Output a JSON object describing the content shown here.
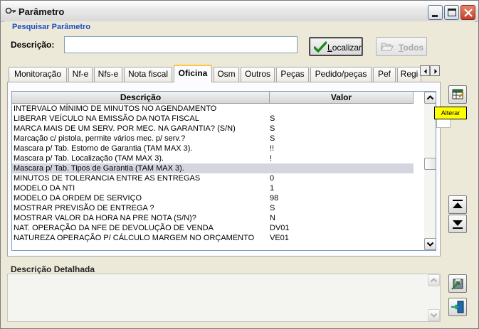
{
  "window": {
    "title": "Parâmetro"
  },
  "search": {
    "section_title": "Pesquisar Parâmetro",
    "description_label": "Descrição:",
    "description_value": "",
    "localizar_label_u": "L",
    "localizar_label_rest": "ocalizar",
    "todos_label_u": "T",
    "todos_label_rest": "odos"
  },
  "tabs": [
    {
      "label": "Monitoração"
    },
    {
      "label": "Nf-e"
    },
    {
      "label": "Nfs-e"
    },
    {
      "label": "Nota fiscal"
    },
    {
      "label": "Oficina",
      "active": true
    },
    {
      "label": "Osm"
    },
    {
      "label": "Outros"
    },
    {
      "label": "Peças"
    },
    {
      "label": "Pedido/peças"
    },
    {
      "label": "Pef"
    },
    {
      "label": "Regi"
    }
  ],
  "grid": {
    "columns": [
      "Descrição",
      "Valor"
    ],
    "rows": [
      {
        "desc": "INTERVALO MÍNIMO DE MINUTOS NO AGENDAMENTO",
        "value": ""
      },
      {
        "desc": "LIBERAR VEÍCULO NA EMISSÃO DA NOTA FISCAL",
        "value": "S"
      },
      {
        "desc": "MARCA MAIS DE UM SERV. POR MEC. NA GARANTIA? (S/N)",
        "value": "S"
      },
      {
        "desc": "Marcação c/ pistola, permite vários mec. p/ serv.?",
        "value": "S"
      },
      {
        "desc": "Mascara p/ Tab. Estorno de Garantia (TAM MAX 3).",
        "value": "!!"
      },
      {
        "desc": "Mascara p/ Tab. Localização (TAM MAX 3).",
        "value": "!"
      },
      {
        "desc": "Mascara p/ Tab. Tipos de Garantia (TAM MAX 3).",
        "value": "",
        "selected": true
      },
      {
        "desc": "MINUTOS DE TOLERANCIA ENTRE AS ENTREGAS",
        "value": "0"
      },
      {
        "desc": "MODELO DA NTI",
        "value": "1"
      },
      {
        "desc": "MODELO DA ORDEM DE SERVIÇO",
        "value": "98"
      },
      {
        "desc": "MOSTRAR PREVISÃO DE ENTREGA ?",
        "value": "S"
      },
      {
        "desc": "MOSTRAR VALOR DA HORA NA PRE NOTA (S/N)?",
        "value": "N"
      },
      {
        "desc": "NAT. OPERAÇÃO DA NFE DE DEVOLUÇÃO DE VENDA",
        "value": "DV01"
      },
      {
        "desc": "NATUREZA OPERAÇÃO P/ CÁLCULO MARGEM NO ORÇAMENTO",
        "value": "VE01"
      }
    ]
  },
  "tooltip": {
    "text": "Alterar"
  },
  "detail": {
    "label": "Descrição Detalhada",
    "value": ""
  },
  "icons": {
    "title": "key-icon",
    "localizar": "checkmark-icon",
    "todos": "folder-open-icon",
    "alterar": "edit-grid-icon",
    "move_top": "move-top-icon",
    "move_down": "move-down-icon",
    "export": "export-icon",
    "exit": "exit-door-icon"
  }
}
